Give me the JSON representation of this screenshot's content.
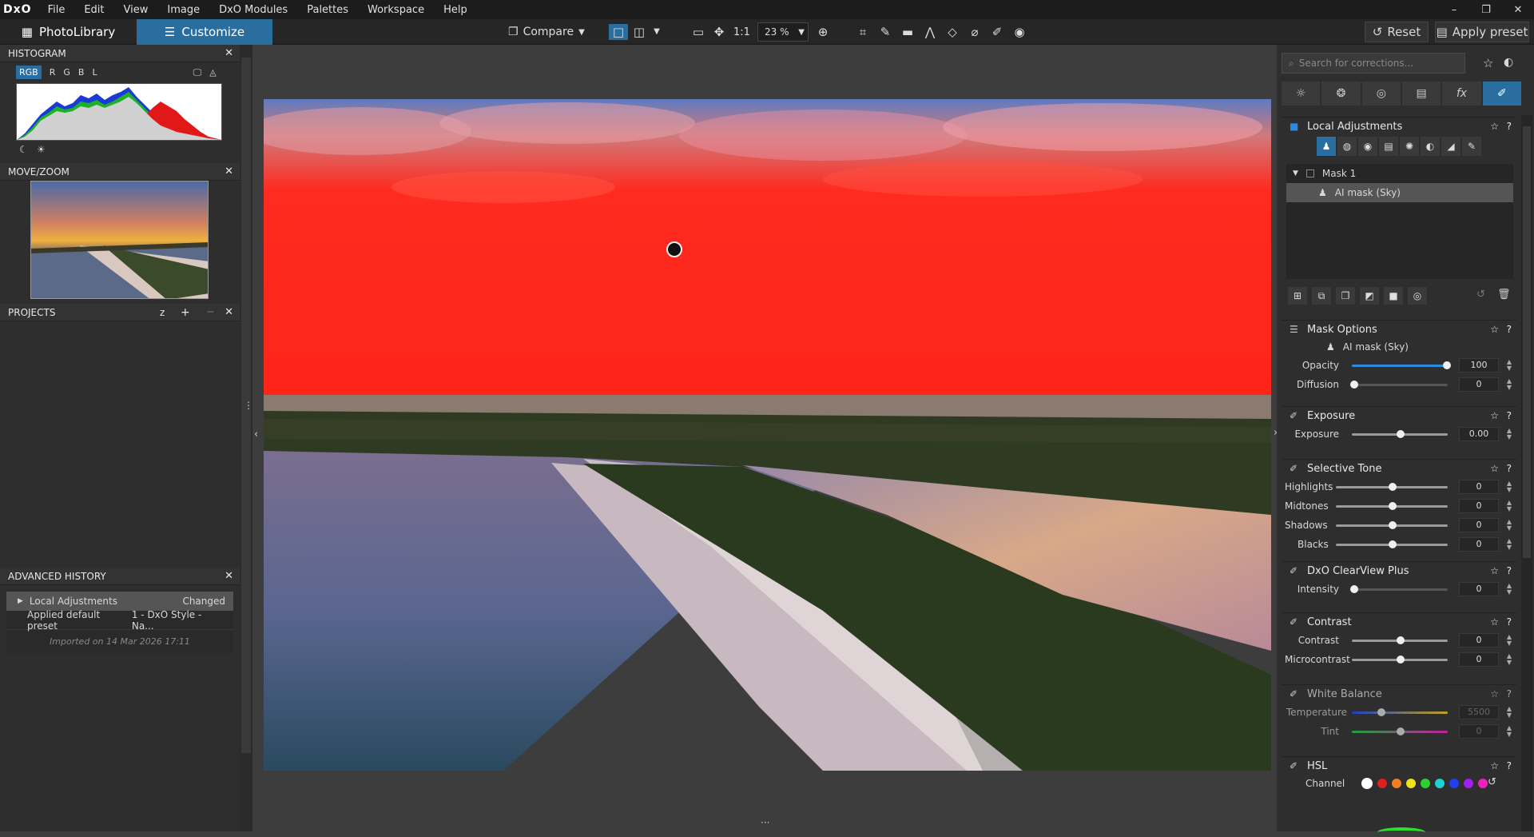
{
  "menubar": {
    "logo": "DxO",
    "items": [
      "File",
      "Edit",
      "View",
      "Image",
      "DxO Modules",
      "Palettes",
      "Workspace",
      "Help"
    ],
    "window_controls": [
      "–",
      "❐",
      "✕"
    ]
  },
  "toolbar": {
    "photolibrary_label": "PhotoLibrary",
    "customize_label": "Customize",
    "compare_label": "Compare",
    "ratio_label": "1:1",
    "zoom_value": "23 %",
    "reset_label": "Reset",
    "apply_preset_label": "Apply preset"
  },
  "left": {
    "histogram_title": "HISTOGRAM",
    "histogram_channels": [
      "RGB",
      "R",
      "G",
      "B",
      "L"
    ],
    "movezoom_title": "MOVE/ZOOM",
    "projects_title": "PROJECTS",
    "projects_sort": "z",
    "projects_add": "+",
    "projects_remove": "−",
    "history_title": "ADVANCED HISTORY",
    "history": [
      {
        "name": "Local Adjustments",
        "value": "Changed"
      },
      {
        "name": "Applied default preset",
        "value": "1 - DxO Style - Na..."
      }
    ],
    "imported_text": "Imported on 14 Mar 2026 17:11"
  },
  "right": {
    "search_placeholder": "Search for corrections...",
    "local_adjustments_title": "Local Adjustments",
    "mask_group": "Mask 1",
    "mask_item": "AI mask (Sky)",
    "mask_options_title": "Mask Options",
    "mask_options_item": "AI mask (Sky)",
    "opacity_label": "Opacity",
    "opacity_value": "100",
    "diffusion_label": "Diffusion",
    "diffusion_value": "0",
    "exposure_title": "Exposure",
    "exposure_label": "Exposure",
    "exposure_value": "0.00",
    "selective_tone_title": "Selective Tone",
    "highlights_label": "Highlights",
    "highlights_value": "0",
    "midtones_label": "Midtones",
    "midtones_value": "0",
    "shadows_label": "Shadows",
    "shadows_value": "0",
    "blacks_label": "Blacks",
    "blacks_value": "0",
    "clearview_title": "DxO ClearView Plus",
    "intensity_label": "Intensity",
    "intensity_value": "0",
    "contrast_title": "Contrast",
    "contrast_label": "Contrast",
    "contrast_value": "0",
    "microcontrast_label": "Microcontrast",
    "microcontrast_value": "0",
    "wb_title": "White Balance",
    "temperature_label": "Temperature",
    "temperature_value": "5500",
    "tint_label": "Tint",
    "tint_value": "0",
    "hsl_title": "HSL",
    "channel_label": "Channel",
    "channel_colors": [
      "#ffffff",
      "#e02020",
      "#f08020",
      "#f0e020",
      "#30d030",
      "#20d0d0",
      "#2040f0",
      "#a020f0",
      "#f020c0"
    ],
    "star": "☆",
    "help": "?"
  }
}
